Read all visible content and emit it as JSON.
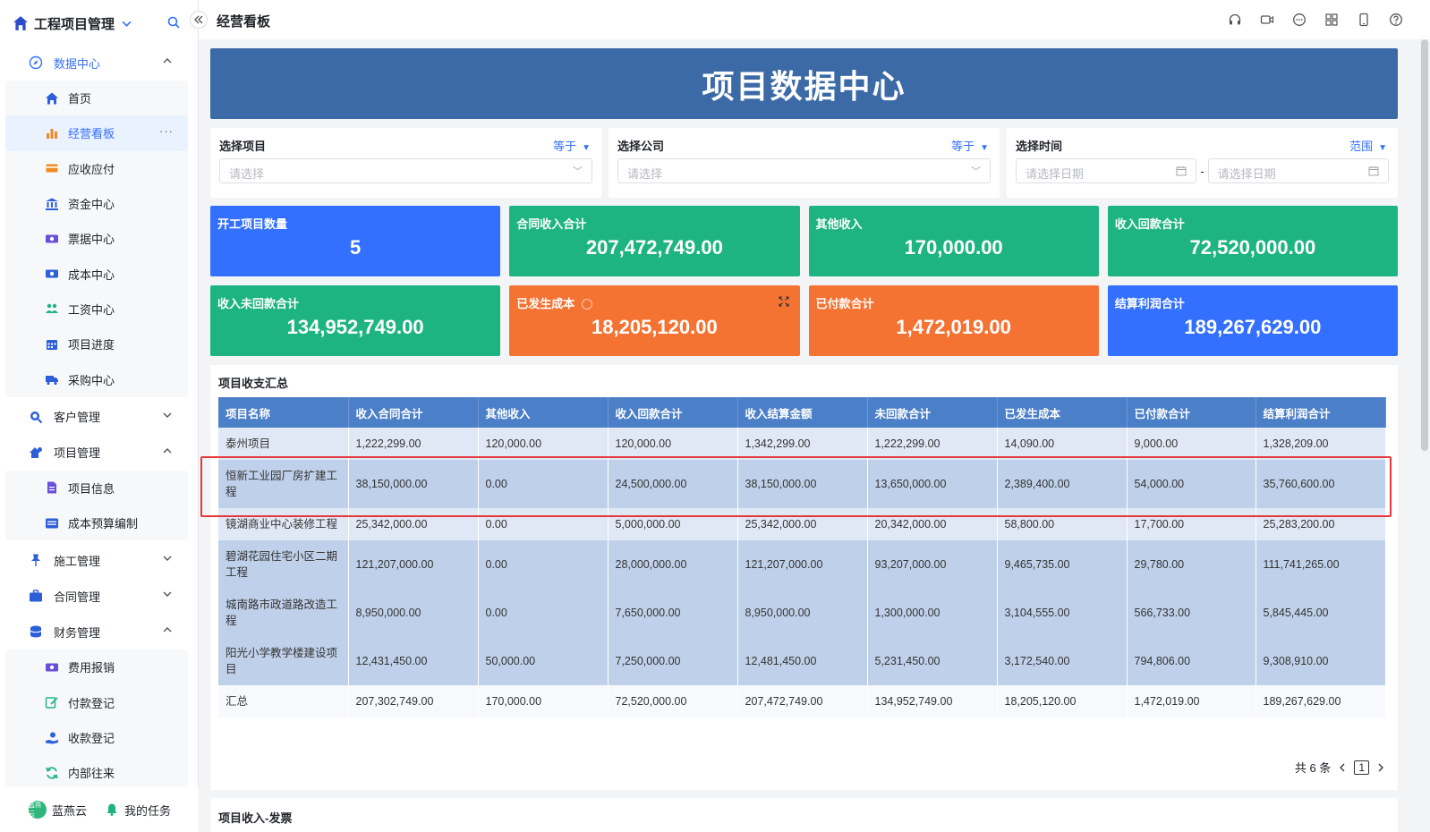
{
  "sidebar": {
    "brand": "工程项目管理",
    "groups": {
      "data_center": "数据中心",
      "customer": "客户管理",
      "project": "项目管理",
      "construction": "施工管理",
      "contract": "合同管理",
      "finance": "财务管理"
    },
    "data_center_items": [
      "首页",
      "经营看板",
      "应收应付",
      "资金中心",
      "票据中心",
      "成本中心",
      "工资中心",
      "项目进度",
      "采购中心"
    ],
    "project_items": [
      "项目信息",
      "成本预算编制"
    ],
    "finance_items": [
      "费用报销",
      "付款登记",
      "收款登记",
      "内部往来"
    ],
    "more": "···",
    "footer": {
      "avatar_text": "蓝燕云",
      "user": "蓝燕云",
      "tasks": "我的任务"
    }
  },
  "topbar": {
    "title": "经营看板"
  },
  "banner": {
    "title": "项目数据中心"
  },
  "filters": {
    "project": {
      "label": "选择项目",
      "op": "等于",
      "placeholder": "请选择"
    },
    "company": {
      "label": "选择公司",
      "op": "等于",
      "placeholder": "请选择"
    },
    "time": {
      "label": "选择时间",
      "op": "范围",
      "start": "请选择日期",
      "end": "请选择日期",
      "sep": "-"
    }
  },
  "cards": [
    {
      "label": "开工项目数量",
      "value": "5",
      "color": "#3370ff"
    },
    {
      "label": "合同收入合计",
      "value": "207,472,749.00",
      "color": "#1eb482"
    },
    {
      "label": "其他收入",
      "value": "170,000.00",
      "color": "#1eb482"
    },
    {
      "label": "收入回款合计",
      "value": "72,520,000.00",
      "color": "#1eb482"
    },
    {
      "label": "收入未回款合计",
      "value": "134,952,749.00",
      "color": "#1eb482"
    },
    {
      "label": "已发生成本",
      "value": "18,205,120.00",
      "color": "#f57332"
    },
    {
      "label": "已付款合计",
      "value": "1,472,019.00",
      "color": "#f57332"
    },
    {
      "label": "结算利润合计",
      "value": "189,267,629.00",
      "color": "#3370ff"
    }
  ],
  "summary": {
    "title": "项目收支汇总",
    "columns": [
      "项目名称",
      "收入合同合计",
      "其他收入",
      "收入回款合计",
      "收入结算金额",
      "未回款合计",
      "已发生成本",
      "已付款合计",
      "结算利润合计"
    ],
    "rows": [
      [
        "泰州项目",
        "1,222,299.00",
        "120,000.00",
        "120,000.00",
        "1,342,299.00",
        "1,222,299.00",
        "14,090.00",
        "9,000.00",
        "1,328,209.00"
      ],
      [
        "恒新工业园厂房扩建工程",
        "38,150,000.00",
        "0.00",
        "24,500,000.00",
        "38,150,000.00",
        "13,650,000.00",
        "2,389,400.00",
        "54,000.00",
        "35,760,600.00"
      ],
      [
        "镜湖商业中心装修工程",
        "25,342,000.00",
        "0.00",
        "5,000,000.00",
        "25,342,000.00",
        "20,342,000.00",
        "58,800.00",
        "17,700.00",
        "25,283,200.00"
      ],
      [
        "碧湖花园住宅小区二期工程",
        "121,207,000.00",
        "0.00",
        "28,000,000.00",
        "121,207,000.00",
        "93,207,000.00",
        "9,465,735.00",
        "29,780.00",
        "111,741,265.00"
      ],
      [
        "城南路市政道路改造工程",
        "8,950,000.00",
        "0.00",
        "7,650,000.00",
        "8,950,000.00",
        "1,300,000.00",
        "3,104,555.00",
        "566,733.00",
        "5,845,445.00"
      ],
      [
        "阳光小学教学楼建设项目",
        "12,431,450.00",
        "50,000.00",
        "7,250,000.00",
        "12,481,450.00",
        "5,231,450.00",
        "3,172,540.00",
        "794,806.00",
        "9,308,910.00"
      ],
      [
        "汇总",
        "207,302,749.00",
        "170,000.00",
        "72,520,000.00",
        "207,472,749.00",
        "134,952,749.00",
        "18,205,120.00",
        "1,472,019.00",
        "189,267,629.00"
      ]
    ],
    "pager": {
      "total": "共 6 条",
      "page": "1"
    }
  },
  "panel2": {
    "title": "项目收入-发票"
  }
}
